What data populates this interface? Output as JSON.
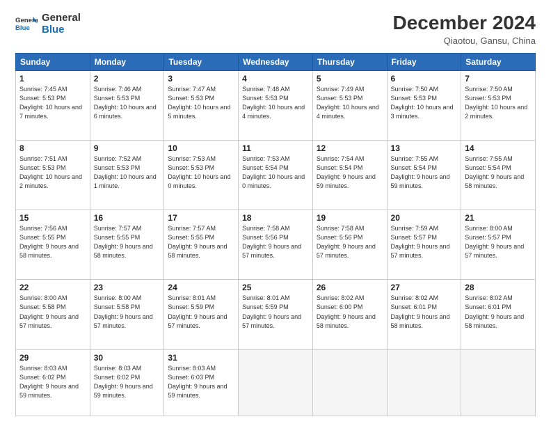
{
  "header": {
    "logo_line1": "General",
    "logo_line2": "Blue",
    "month_title": "December 2024",
    "location": "Qiaotou, Gansu, China"
  },
  "weekdays": [
    "Sunday",
    "Monday",
    "Tuesday",
    "Wednesday",
    "Thursday",
    "Friday",
    "Saturday"
  ],
  "weeks": [
    [
      {
        "day": "1",
        "sunrise": "7:45 AM",
        "sunset": "5:53 PM",
        "daylight": "10 hours and 7 minutes."
      },
      {
        "day": "2",
        "sunrise": "7:46 AM",
        "sunset": "5:53 PM",
        "daylight": "10 hours and 6 minutes."
      },
      {
        "day": "3",
        "sunrise": "7:47 AM",
        "sunset": "5:53 PM",
        "daylight": "10 hours and 5 minutes."
      },
      {
        "day": "4",
        "sunrise": "7:48 AM",
        "sunset": "5:53 PM",
        "daylight": "10 hours and 4 minutes."
      },
      {
        "day": "5",
        "sunrise": "7:49 AM",
        "sunset": "5:53 PM",
        "daylight": "10 hours and 4 minutes."
      },
      {
        "day": "6",
        "sunrise": "7:50 AM",
        "sunset": "5:53 PM",
        "daylight": "10 hours and 3 minutes."
      },
      {
        "day": "7",
        "sunrise": "7:50 AM",
        "sunset": "5:53 PM",
        "daylight": "10 hours and 2 minutes."
      }
    ],
    [
      {
        "day": "8",
        "sunrise": "7:51 AM",
        "sunset": "5:53 PM",
        "daylight": "10 hours and 2 minutes."
      },
      {
        "day": "9",
        "sunrise": "7:52 AM",
        "sunset": "5:53 PM",
        "daylight": "10 hours and 1 minute."
      },
      {
        "day": "10",
        "sunrise": "7:53 AM",
        "sunset": "5:53 PM",
        "daylight": "10 hours and 0 minutes."
      },
      {
        "day": "11",
        "sunrise": "7:53 AM",
        "sunset": "5:54 PM",
        "daylight": "10 hours and 0 minutes."
      },
      {
        "day": "12",
        "sunrise": "7:54 AM",
        "sunset": "5:54 PM",
        "daylight": "9 hours and 59 minutes."
      },
      {
        "day": "13",
        "sunrise": "7:55 AM",
        "sunset": "5:54 PM",
        "daylight": "9 hours and 59 minutes."
      },
      {
        "day": "14",
        "sunrise": "7:55 AM",
        "sunset": "5:54 PM",
        "daylight": "9 hours and 58 minutes."
      }
    ],
    [
      {
        "day": "15",
        "sunrise": "7:56 AM",
        "sunset": "5:55 PM",
        "daylight": "9 hours and 58 minutes."
      },
      {
        "day": "16",
        "sunrise": "7:57 AM",
        "sunset": "5:55 PM",
        "daylight": "9 hours and 58 minutes."
      },
      {
        "day": "17",
        "sunrise": "7:57 AM",
        "sunset": "5:55 PM",
        "daylight": "9 hours and 58 minutes."
      },
      {
        "day": "18",
        "sunrise": "7:58 AM",
        "sunset": "5:56 PM",
        "daylight": "9 hours and 57 minutes."
      },
      {
        "day": "19",
        "sunrise": "7:58 AM",
        "sunset": "5:56 PM",
        "daylight": "9 hours and 57 minutes."
      },
      {
        "day": "20",
        "sunrise": "7:59 AM",
        "sunset": "5:57 PM",
        "daylight": "9 hours and 57 minutes."
      },
      {
        "day": "21",
        "sunrise": "8:00 AM",
        "sunset": "5:57 PM",
        "daylight": "9 hours and 57 minutes."
      }
    ],
    [
      {
        "day": "22",
        "sunrise": "8:00 AM",
        "sunset": "5:58 PM",
        "daylight": "9 hours and 57 minutes."
      },
      {
        "day": "23",
        "sunrise": "8:00 AM",
        "sunset": "5:58 PM",
        "daylight": "9 hours and 57 minutes."
      },
      {
        "day": "24",
        "sunrise": "8:01 AM",
        "sunset": "5:59 PM",
        "daylight": "9 hours and 57 minutes."
      },
      {
        "day": "25",
        "sunrise": "8:01 AM",
        "sunset": "5:59 PM",
        "daylight": "9 hours and 57 minutes."
      },
      {
        "day": "26",
        "sunrise": "8:02 AM",
        "sunset": "6:00 PM",
        "daylight": "9 hours and 58 minutes."
      },
      {
        "day": "27",
        "sunrise": "8:02 AM",
        "sunset": "6:01 PM",
        "daylight": "9 hours and 58 minutes."
      },
      {
        "day": "28",
        "sunrise": "8:02 AM",
        "sunset": "6:01 PM",
        "daylight": "9 hours and 58 minutes."
      }
    ],
    [
      {
        "day": "29",
        "sunrise": "8:03 AM",
        "sunset": "6:02 PM",
        "daylight": "9 hours and 59 minutes."
      },
      {
        "day": "30",
        "sunrise": "8:03 AM",
        "sunset": "6:02 PM",
        "daylight": "9 hours and 59 minutes."
      },
      {
        "day": "31",
        "sunrise": "8:03 AM",
        "sunset": "6:03 PM",
        "daylight": "9 hours and 59 minutes."
      },
      null,
      null,
      null,
      null
    ]
  ]
}
